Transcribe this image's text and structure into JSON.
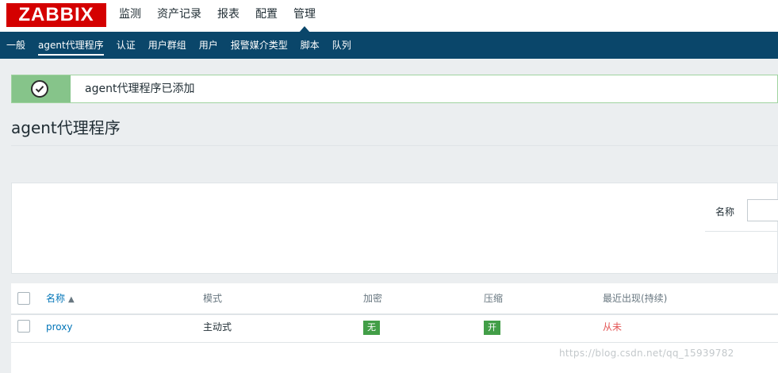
{
  "logo": {
    "text": "ZABBIX",
    "color": "#d40000"
  },
  "main_menu": {
    "items": [
      {
        "label": "监测"
      },
      {
        "label": "资产记录"
      },
      {
        "label": "报表"
      },
      {
        "label": "配置"
      },
      {
        "label": "管理"
      }
    ],
    "active": "管理"
  },
  "sub_menu": {
    "items": [
      {
        "label": "一般"
      },
      {
        "label": "agent代理程序"
      },
      {
        "label": "认证"
      },
      {
        "label": "用户群组"
      },
      {
        "label": "用户"
      },
      {
        "label": "报警媒介类型"
      },
      {
        "label": "脚本"
      },
      {
        "label": "队列"
      }
    ],
    "active": "agent代理程序",
    "background": "#0a466a"
  },
  "message": {
    "text": "agent代理程序已添加",
    "icon": "check-circle-icon",
    "color": "#86c48a"
  },
  "page": {
    "title": "agent代理程序"
  },
  "filter": {
    "name_label": "名称",
    "name_value": ""
  },
  "table": {
    "headers": {
      "name": "名称",
      "sort_indicator": "▲",
      "mode": "模式",
      "encryption": "加密",
      "compression": "压缩",
      "last_seen": "最近出现(持续)"
    },
    "rows": [
      {
        "name": "proxy",
        "mode": "主动式",
        "encryption": "无",
        "compression": "开",
        "last_seen": "从未"
      }
    ]
  },
  "watermark": "https://blog.csdn.net/qq_15939782"
}
